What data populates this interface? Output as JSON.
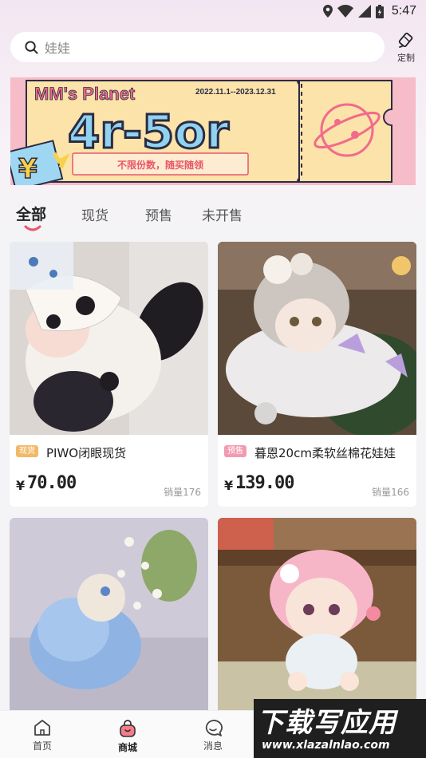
{
  "status_bar": {
    "time": "5:47"
  },
  "search": {
    "placeholder": "娃娃"
  },
  "custom": {
    "label": "定制"
  },
  "banner": {
    "title": "MM's Planet",
    "dates": "2022.11.1--2023.12.31",
    "headline": "4r-5or",
    "subtitle": "不限份数，随买随领",
    "side_text": "¥"
  },
  "tabs": [
    {
      "label": "全部",
      "active": true
    },
    {
      "label": "现货",
      "active": false
    },
    {
      "label": "预售",
      "active": false
    },
    {
      "label": "未开售",
      "active": false
    }
  ],
  "products": [
    {
      "badge": "现货",
      "badge_color": "#f2b968",
      "name": "PIWO闭眼现货",
      "price": "70.00",
      "price_symbol": "¥",
      "sales": "销量176"
    },
    {
      "badge": "预售",
      "badge_color": "#f39ab2",
      "name": "暮恩20cm柔软丝棉花娃娃",
      "price": "139.00",
      "price_symbol": "¥",
      "sales": "销量166"
    },
    {
      "badge": "",
      "name": "",
      "price": "",
      "sales": ""
    },
    {
      "badge": "",
      "name": "",
      "price": "",
      "sales": ""
    }
  ],
  "bottom_nav": [
    {
      "label": "首页",
      "icon": "home-icon",
      "active": false
    },
    {
      "label": "商城",
      "icon": "shop-bag-icon",
      "active": true
    },
    {
      "label": "消息",
      "icon": "message-icon",
      "active": false
    }
  ],
  "watermark": {
    "title": "下载写应用",
    "url": "www.xlazalnlao.com"
  },
  "colors": {
    "accent": "#e8576a",
    "background": "#f4f3f6",
    "banner_bg": "#f9e7a8"
  }
}
